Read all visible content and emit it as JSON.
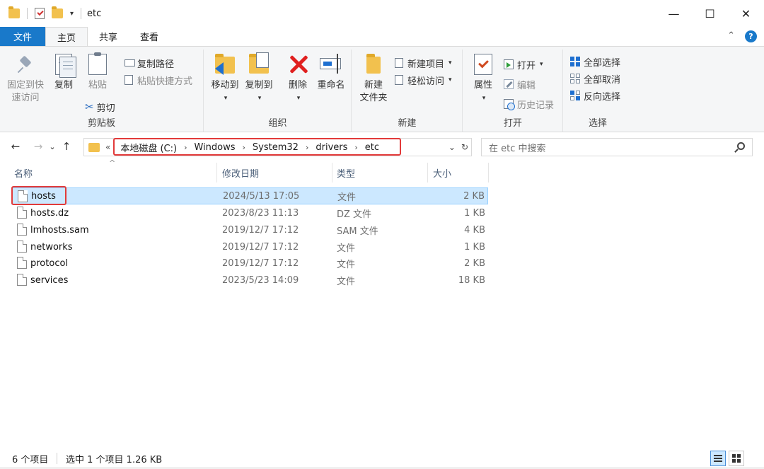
{
  "window": {
    "title": "etc",
    "controls": {
      "minimize": "—",
      "maximize": "☐",
      "close": "✕"
    }
  },
  "ribbon_tabs": {
    "file": "文件",
    "home": "主页",
    "share": "共享",
    "view": "查看"
  },
  "ribbon": {
    "clipboard": {
      "label": "剪贴板",
      "pin": "固定到快\n速访问",
      "pin_line1": "固定到快",
      "pin_line2": "速访问",
      "copy": "复制",
      "paste": "粘贴",
      "copy_path": "复制路径",
      "paste_shortcut": "粘贴快捷方式",
      "cut": "剪切"
    },
    "organize": {
      "label": "组织",
      "move_to": "移动到",
      "copy_to": "复制到",
      "delete": "删除",
      "rename": "重命名"
    },
    "new": {
      "label": "新建",
      "new_folder_line1": "新建",
      "new_folder_line2": "文件夹",
      "new_item": "新建项目",
      "easy_access": "轻松访问"
    },
    "open": {
      "label": "打开",
      "properties": "属性",
      "open": "打开",
      "edit": "编辑",
      "history": "历史记录"
    },
    "select": {
      "label": "选择",
      "select_all": "全部选择",
      "select_none": "全部取消",
      "invert": "反向选择"
    }
  },
  "address": {
    "overflow": "«",
    "crumbs": [
      "本地磁盘 (C:)",
      "Windows",
      "System32",
      "drivers",
      "etc"
    ],
    "search_placeholder": "在 etc 中搜索"
  },
  "columns": {
    "name": "名称",
    "modified": "修改日期",
    "type": "类型",
    "size": "大小"
  },
  "files": [
    {
      "name": "hosts",
      "modified": "2024/5/13 17:05",
      "type": "文件",
      "size": "2 KB",
      "selected": true
    },
    {
      "name": "hosts.dz",
      "modified": "2023/8/23 11:13",
      "type": "DZ 文件",
      "size": "1 KB"
    },
    {
      "name": "lmhosts.sam",
      "modified": "2019/12/7 17:12",
      "type": "SAM 文件",
      "size": "4 KB"
    },
    {
      "name": "networks",
      "modified": "2019/12/7 17:12",
      "type": "文件",
      "size": "1 KB"
    },
    {
      "name": "protocol",
      "modified": "2019/12/7 17:12",
      "type": "文件",
      "size": "2 KB"
    },
    {
      "name": "services",
      "modified": "2023/5/23 14:09",
      "type": "文件",
      "size": "18 KB"
    }
  ],
  "status": {
    "count": "6 个项目",
    "selection": "选中 1 个项目  1.26 KB"
  },
  "colors": {
    "file_tab": "#1979ca",
    "selection": "#cce8ff",
    "highlight": "#e23a3a"
  }
}
